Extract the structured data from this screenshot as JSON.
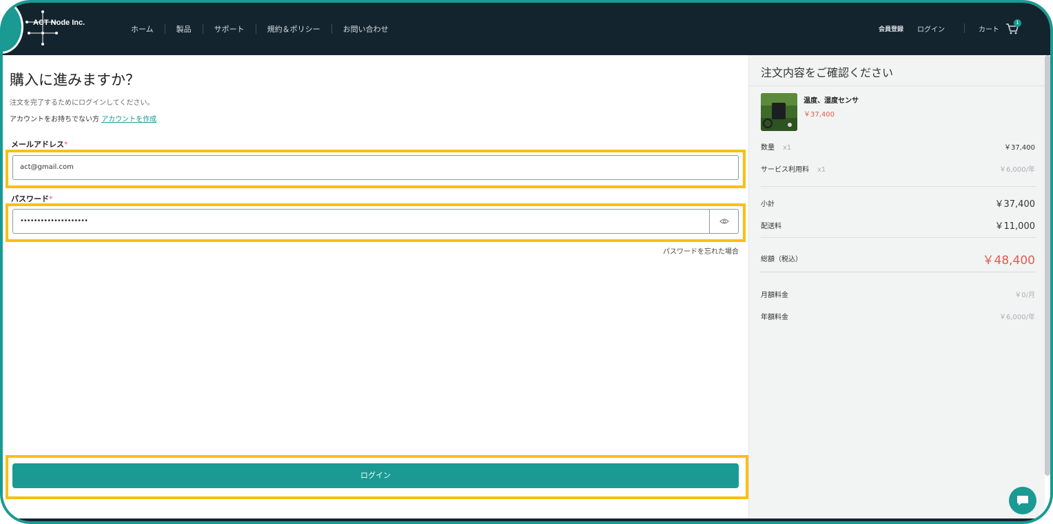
{
  "header": {
    "logo_text": "ACT Node Inc.",
    "nav": [
      "ホーム",
      "製品",
      "サポート",
      "規約＆ポリシー",
      "お問い合わせ"
    ],
    "register_label": "会員登録",
    "login_label": "ログイン",
    "cart_label": "カート",
    "cart_count": "1"
  },
  "main": {
    "title": "購入に進みますか？",
    "intro": "注文を完了するためにログインしてください。",
    "signup_prompt": "アカウントをお持ちでない方",
    "signup_link": "アカウントを作成",
    "email_label": "メールアドレス",
    "email_value": "act@gmail.com",
    "password_label": "パスワード",
    "password_value": "••••••••••••••••••••",
    "required_mark": "*",
    "forgot_password": "パスワードを忘れた場合",
    "login_button": "ログイン"
  },
  "summary": {
    "title": "注文内容をご確認ください",
    "product_name": "温度、湿度センサ",
    "product_price": "￥37,400",
    "rows": {
      "quantity_label": "数量",
      "quantity_count": "x1",
      "quantity_value": "￥37,400",
      "service_label": "サービス利用料",
      "service_count": "x1",
      "service_value": "￥6,000/年",
      "subtotal_label": "小計",
      "subtotal_value": "￥37,400",
      "shipping_label": "配送料",
      "shipping_value": "￥11,000",
      "total_label": "総額（税込）",
      "total_value": "￥48,400",
      "monthly_label": "月額料金",
      "monthly_value": "￥0/月",
      "yearly_label": "年額料金",
      "yearly_value": "￥6,000/年"
    }
  },
  "colors": {
    "header_bg": "#14242e",
    "accent": "#1a9a93",
    "highlight": "#fbbf12",
    "price_red": "#e05c4c"
  }
}
